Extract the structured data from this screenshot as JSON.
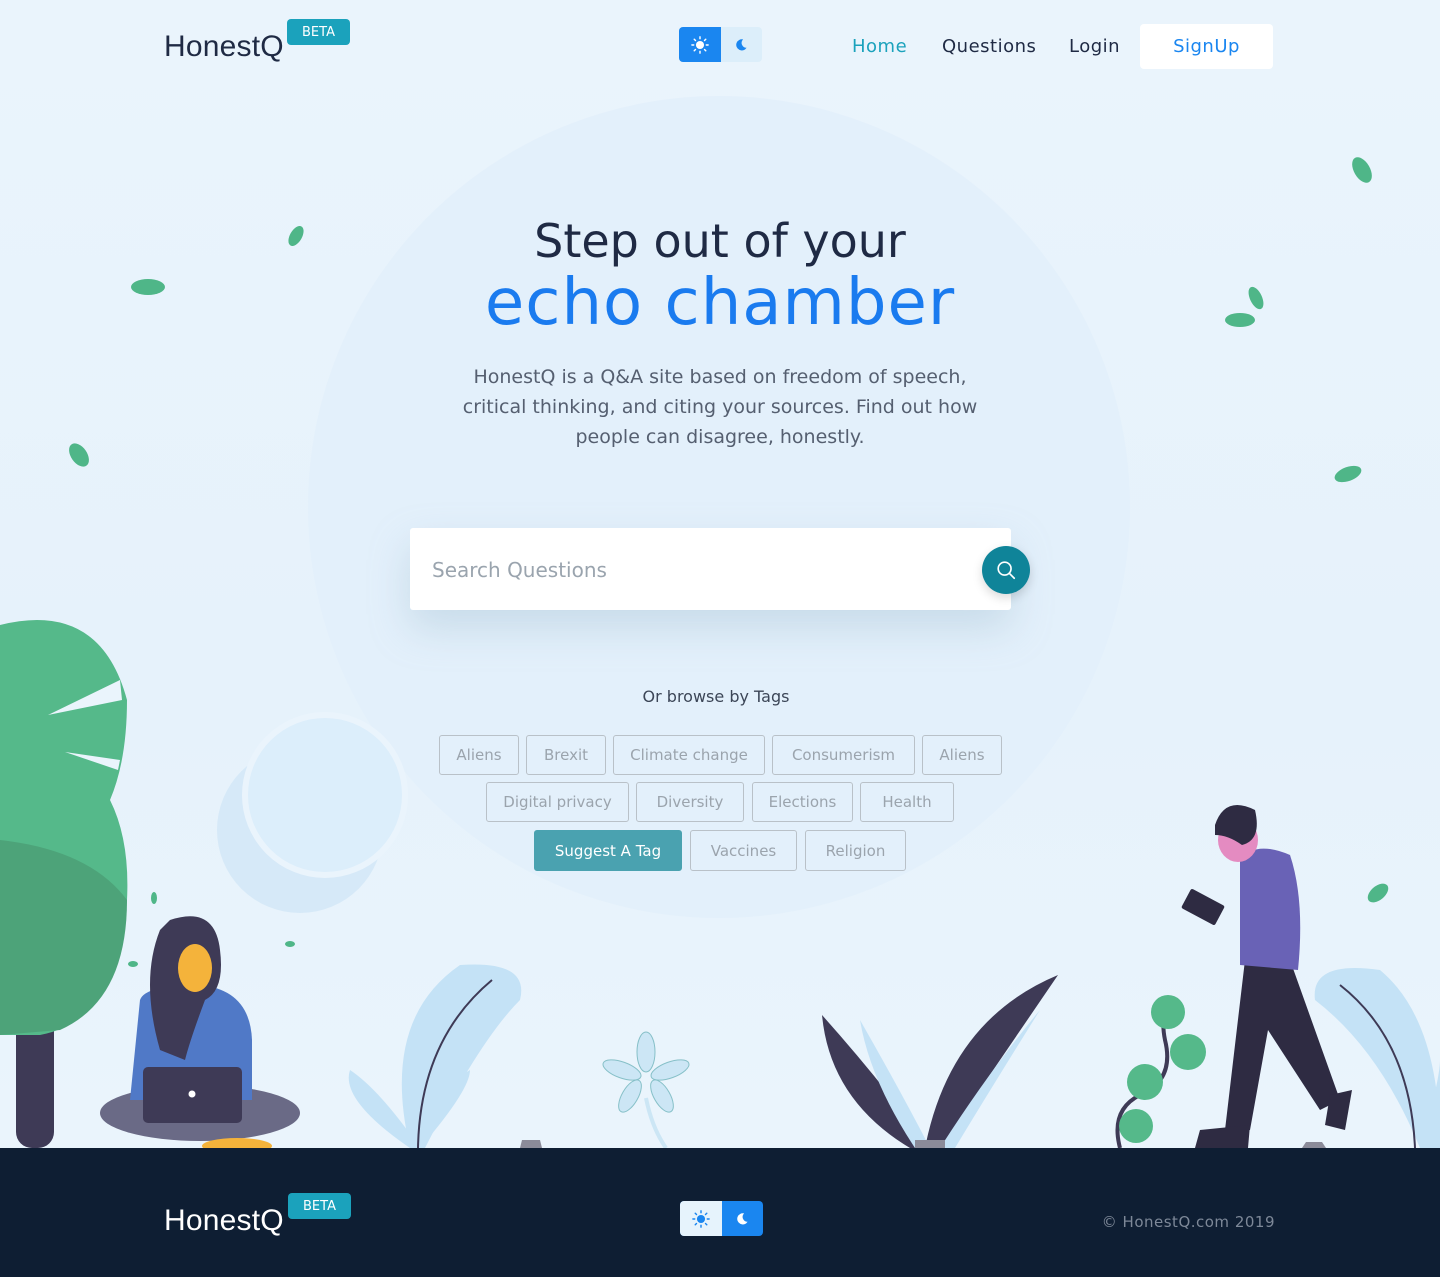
{
  "header": {
    "logo": "HonestQ",
    "badge": "BETA",
    "nav": {
      "home": "Home",
      "questions": "Questions",
      "login": "Login",
      "signup": "SignUp"
    },
    "theme_icons": [
      "sun-icon",
      "moon-icon"
    ]
  },
  "hero": {
    "line1": "Step out of your",
    "line2": "echo chamber",
    "description": "HonestQ is a Q&A site based on freedom of speech, critical thinking, and citing your sources. Find out how people can disagree, honestly."
  },
  "search": {
    "placeholder": "Search Questions"
  },
  "tags": {
    "heading": "Or browse by Tags",
    "row1": [
      "Aliens",
      "Brexit",
      "Climate change",
      "Consumerism",
      "Aliens"
    ],
    "row2": [
      "Digital privacy",
      "Diversity",
      "Elections",
      "Health"
    ],
    "suggest": "Suggest A Tag",
    "row3": [
      "Vaccines",
      "Religion"
    ]
  },
  "footer": {
    "logo": "HonestQ",
    "badge": "BETA",
    "copyright": "© HonestQ.com 2019"
  },
  "colors": {
    "accent": "#1a86f0",
    "teal": "#1ba2bc",
    "dark": "#0e1e33",
    "leaf": "#4fb688"
  }
}
